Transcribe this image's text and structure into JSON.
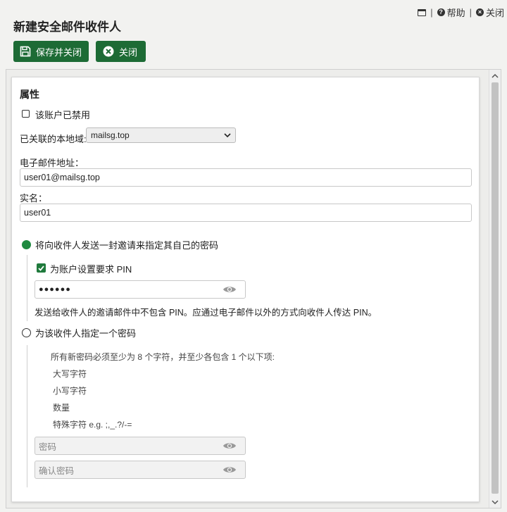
{
  "topbar": {
    "help_label": "帮助",
    "close_label": "关闭"
  },
  "page": {
    "title": "新建安全邮件收件人"
  },
  "toolbar": {
    "save_close_label": "保存并关闭",
    "close_label": "关闭"
  },
  "properties": {
    "section_title": "属性",
    "disabled_checkbox_label": "该账户已禁用",
    "disabled_checked": false,
    "local_domain_label": "已关联的本地域:",
    "local_domain_value": "mailsg.top",
    "email_label": "电子邮件地址：",
    "email_value": "user01@mailsg.top",
    "realname_label": "实名：",
    "realname_value": "user01"
  },
  "password_options": {
    "invite_radio_label": "将向收件人发送一封邀请来指定其自己的密码",
    "invite_selected": true,
    "pin_checkbox_label": "为账户设置要求 PIN",
    "pin_checked": true,
    "pin_value": "●●●●●●",
    "pin_note": "发送给收件人的邀请邮件中不包含 PIN。应通过电子邮件以外的方式向收件人传达 PIN。",
    "assign_radio_label": "为该收件人指定一个密码",
    "assign_selected": false,
    "requirements_intro": "所有新密码必须至少为 8 个字符，并至少各包含 1 个以下项:",
    "requirements": [
      "大写字符",
      "小写字符",
      "数量",
      "特殊字符 e.g. ;,_.?/-="
    ],
    "password_placeholder": "密码",
    "confirm_placeholder": "确认密码"
  },
  "icons": {
    "window": "window-icon",
    "help": "help-icon",
    "close": "close-icon",
    "save": "save-icon",
    "eye": "eye-icon"
  },
  "colors": {
    "accent": "#1d6b35",
    "radio_selected": "#1f8a40"
  }
}
